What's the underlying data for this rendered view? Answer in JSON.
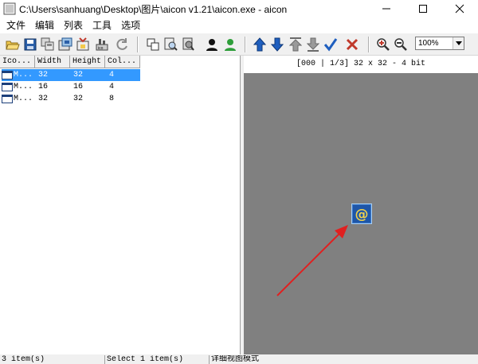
{
  "window": {
    "title": "C:\\Users\\sanhuang\\Desktop\\图片\\aicon v1.21\\aicon.exe - aicon",
    "app_icon": "aicon-app-icon",
    "buttons": [
      "minimize-icon",
      "maximize-icon",
      "close-icon"
    ]
  },
  "menu": {
    "items": [
      "文件",
      "编辑",
      "列表",
      "工具",
      "选项"
    ]
  },
  "toolbar": {
    "icons": [
      "open-folder-icon",
      "save-icon",
      "save-all-icon",
      "extract-icon",
      "extract-selected-icon",
      "export-icon",
      "refresh-icon",
      "copy-icon",
      "search-icon",
      "find-next-icon",
      "user-black-icon",
      "user-green-icon",
      "move-up-icon",
      "move-down-icon",
      "move-top-icon",
      "move-bottom-icon",
      "check-icon",
      "delete-icon",
      "zoom-in-icon",
      "zoom-out-icon"
    ],
    "zoom": {
      "value": "100%",
      "dropdown_icon": "chevron-down-icon"
    }
  },
  "list": {
    "columns": [
      "Ico...",
      "Width",
      "Height",
      "Col..."
    ],
    "rows": [
      {
        "name": "M...",
        "width": "32",
        "height": "32",
        "colors": "4",
        "selected": true
      },
      {
        "name": "M...",
        "width": "16",
        "height": "16",
        "colors": "4",
        "selected": false
      },
      {
        "name": "M...",
        "width": "32",
        "height": "32",
        "colors": "8",
        "selected": false
      }
    ]
  },
  "preview": {
    "info": "[000 | 1/3] 32 x 32 - 4 bit",
    "icon": "at-sign-icon",
    "annotation_color": "#e02020",
    "canvas_color": "#808080"
  },
  "status": {
    "count": "3 item(s)",
    "selection": "Select 1 item(s)",
    "view_mode": "详细视图模式"
  },
  "colors": {
    "selection": "#3399ff",
    "toolbar_bg": "#f0f0f0"
  }
}
